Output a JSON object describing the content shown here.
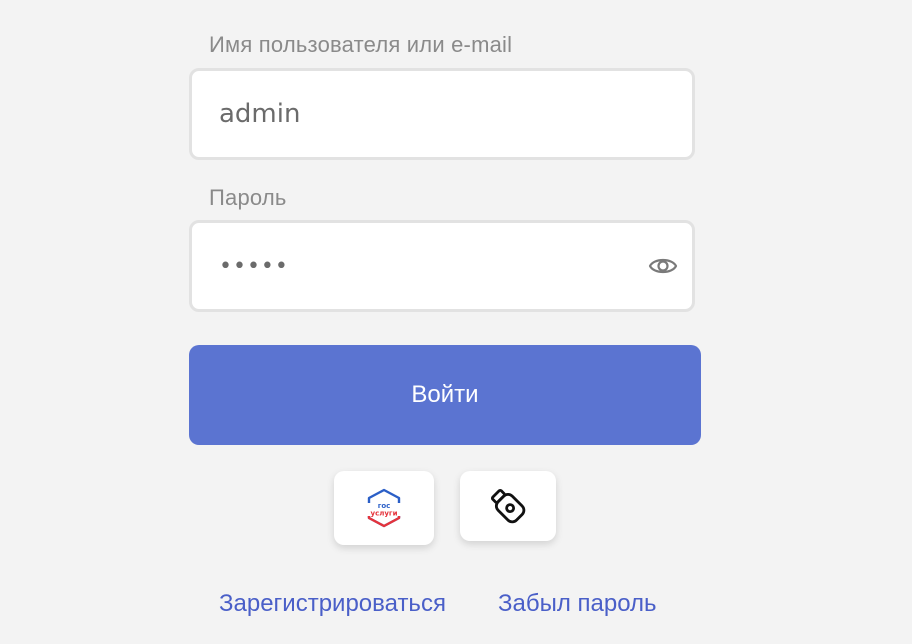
{
  "form": {
    "username_label": "Имя пользователя или e-mail",
    "username_value": "admin",
    "password_label": "Пароль",
    "password_value": "•••••",
    "login_button": "Войти"
  },
  "alt_login": {
    "gosuslugi_icon": "gosuslugi-logo",
    "gosuslugi_text_line1": "гос",
    "gosuslugi_text_line2": "услуги",
    "usb_key_icon": "usb-key-icon"
  },
  "links": {
    "register": "Зарегистрироваться",
    "forgot": "Забыл пароль"
  },
  "colors": {
    "primary": "#5b74d1",
    "link": "#4a5fc8",
    "background": "#f3f3f3"
  }
}
